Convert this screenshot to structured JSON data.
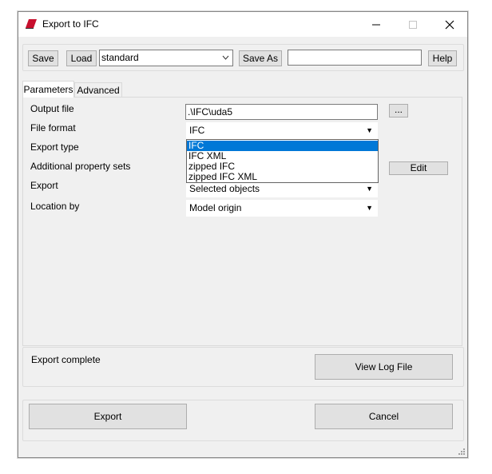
{
  "window": {
    "title": "Export to IFC"
  },
  "toolbar": {
    "save_label": "Save",
    "load_label": "Load",
    "preset_value": "standard",
    "save_as_label": "Save As",
    "save_as_value": "",
    "help_label": "Help"
  },
  "tabs": [
    {
      "label": "Parameters",
      "active": true
    },
    {
      "label": "Advanced",
      "active": false
    }
  ],
  "parameters": {
    "output_file_label": "Output file",
    "output_file_value": ".\\IFC\\uda5",
    "browse_label": "...",
    "file_format_label": "File format",
    "file_format_value": "IFC",
    "export_type_label": "Export type",
    "additional_psets_label": "Additional property sets",
    "edit_label": "Edit",
    "export_label": "Export",
    "export_value": "Selected objects",
    "location_by_label": "Location by",
    "location_by_value": "Model origin"
  },
  "file_format_options": [
    "IFC",
    "IFC XML",
    "zipped IFC",
    "zipped IFC XML"
  ],
  "status": {
    "message": "Export complete",
    "view_log_label": "View Log File"
  },
  "footer": {
    "export_label": "Export",
    "cancel_label": "Cancel"
  },
  "colors": {
    "selection": "#0078d7",
    "window_bg": "#f0f0f0",
    "icon_red": "#c8102e"
  }
}
